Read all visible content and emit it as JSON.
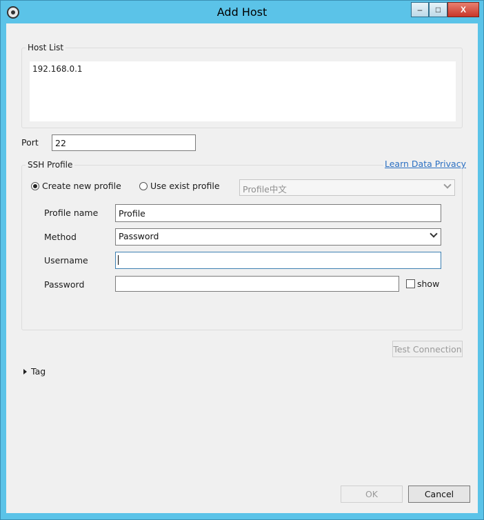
{
  "window": {
    "title": "Add Host",
    "controls": {
      "minimize": "–",
      "maximize": "□",
      "close": "X"
    }
  },
  "host_list": {
    "label": "Host List",
    "items": [
      "192.168.0.1"
    ]
  },
  "port": {
    "label": "Port",
    "value": "22"
  },
  "ssh_profile": {
    "label": "SSH Profile",
    "privacy_link": "Learn Data Privacy",
    "create_new": {
      "label": "Create new profile",
      "checked": true
    },
    "use_exist": {
      "label": "Use exist profile",
      "checked": false
    },
    "existing_profile_select": "Profile中文",
    "fields": {
      "profile_name": {
        "label": "Profile name",
        "value": "Profile"
      },
      "method": {
        "label": "Method",
        "value": "Password"
      },
      "username": {
        "label": "Username",
        "value": ""
      },
      "password": {
        "label": "Password",
        "value": ""
      },
      "show_label": "show"
    }
  },
  "test_connection": "Test Connection",
  "tag": {
    "label": "Tag"
  },
  "footer": {
    "ok": "OK",
    "cancel": "Cancel"
  },
  "colors": {
    "titlebar": "#5bc3e8",
    "client": "#f0f0f0",
    "link": "#2a6fc2"
  }
}
